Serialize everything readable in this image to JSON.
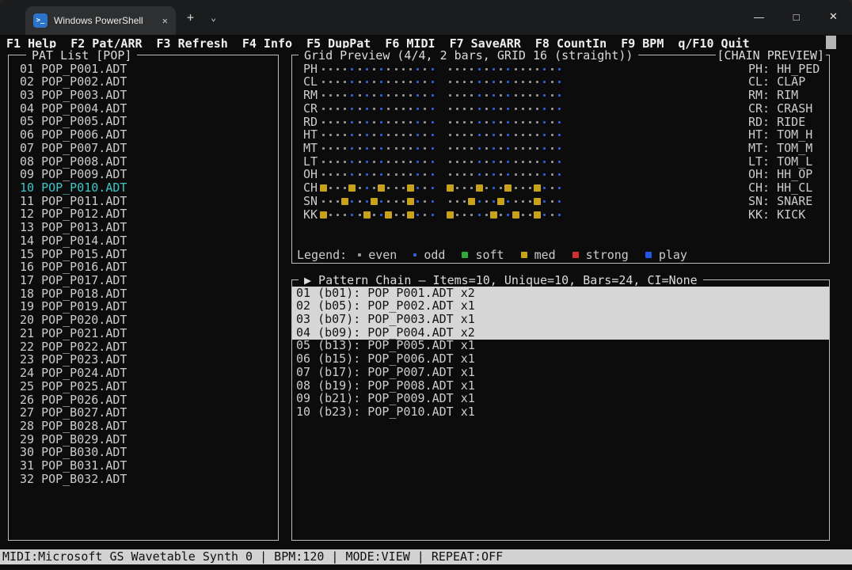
{
  "window": {
    "tab_title": "Windows PowerShell",
    "ps_icon_text": ">_",
    "tab_close_glyph": "✕",
    "new_tab_glyph": "+",
    "dropdown_glyph": "⌄",
    "minimize_glyph": "—",
    "maximize_glyph": "□",
    "close_glyph": "✕"
  },
  "menu": {
    "items": [
      {
        "key": "F1",
        "label": "Help"
      },
      {
        "key": "F2",
        "label": "Pat/ARR"
      },
      {
        "key": "F3",
        "label": "Refresh"
      },
      {
        "key": "F4",
        "label": "Info"
      },
      {
        "key": "F5",
        "label": "DupPat"
      },
      {
        "key": "F6",
        "label": "MIDI"
      },
      {
        "key": "F7",
        "label": "SaveARR"
      },
      {
        "key": "F8",
        "label": "CountIn"
      },
      {
        "key": "F9",
        "label": "BPM"
      },
      {
        "key": "q/F10",
        "label": "Quit"
      }
    ]
  },
  "pat_list": {
    "title": "PAT List [POP]",
    "selected_num": "10",
    "items": [
      {
        "num": "01",
        "name": "POP_P001.ADT"
      },
      {
        "num": "02",
        "name": "POP_P002.ADT"
      },
      {
        "num": "03",
        "name": "POP_P003.ADT"
      },
      {
        "num": "04",
        "name": "POP_P004.ADT"
      },
      {
        "num": "05",
        "name": "POP_P005.ADT"
      },
      {
        "num": "06",
        "name": "POP_P006.ADT"
      },
      {
        "num": "07",
        "name": "POP_P007.ADT"
      },
      {
        "num": "08",
        "name": "POP_P008.ADT"
      },
      {
        "num": "09",
        "name": "POP_P009.ADT"
      },
      {
        "num": "10",
        "name": "POP_P010.ADT"
      },
      {
        "num": "11",
        "name": "POP_P011.ADT"
      },
      {
        "num": "12",
        "name": "POP_P012.ADT"
      },
      {
        "num": "13",
        "name": "POP_P013.ADT"
      },
      {
        "num": "14",
        "name": "POP_P014.ADT"
      },
      {
        "num": "15",
        "name": "POP_P015.ADT"
      },
      {
        "num": "16",
        "name": "POP_P016.ADT"
      },
      {
        "num": "17",
        "name": "POP_P017.ADT"
      },
      {
        "num": "18",
        "name": "POP_P018.ADT"
      },
      {
        "num": "19",
        "name": "POP_P019.ADT"
      },
      {
        "num": "20",
        "name": "POP_P020.ADT"
      },
      {
        "num": "21",
        "name": "POP_P021.ADT"
      },
      {
        "num": "22",
        "name": "POP_P022.ADT"
      },
      {
        "num": "23",
        "name": "POP_P023.ADT"
      },
      {
        "num": "24",
        "name": "POP_P024.ADT"
      },
      {
        "num": "25",
        "name": "POP_P025.ADT"
      },
      {
        "num": "26",
        "name": "POP_P026.ADT"
      },
      {
        "num": "27",
        "name": "POP_B027.ADT"
      },
      {
        "num": "28",
        "name": "POP_B028.ADT"
      },
      {
        "num": "29",
        "name": "POP_B029.ADT"
      },
      {
        "num": "30",
        "name": "POP_B030.ADT"
      },
      {
        "num": "31",
        "name": "POP_B031.ADT"
      },
      {
        "num": "32",
        "name": "POP_B032.ADT"
      }
    ]
  },
  "grid": {
    "title": "Grid Preview (4/4, 2 bars, GRID 16 (straight))",
    "chain_preview_label": "[CHAIN PREVIEW]",
    "bars": 2,
    "steps_per_bar": 16,
    "dot_pattern": "EEEEOEOEOEEEEOEO",
    "rows": [
      {
        "abbr": "PH",
        "name": "HH_PED",
        "hits": []
      },
      {
        "abbr": "CL",
        "name": "CLAP",
        "hits": []
      },
      {
        "abbr": "RM",
        "name": "RIM",
        "hits": []
      },
      {
        "abbr": "CR",
        "name": "CRASH",
        "hits": []
      },
      {
        "abbr": "RD",
        "name": "RIDE",
        "hits": []
      },
      {
        "abbr": "HT",
        "name": "TOM_H",
        "hits": []
      },
      {
        "abbr": "MT",
        "name": "TOM_M",
        "hits": []
      },
      {
        "abbr": "LT",
        "name": "TOM_L",
        "hits": []
      },
      {
        "abbr": "OH",
        "name": "HH_OP",
        "hits": []
      },
      {
        "abbr": "CH",
        "name": "HH_CL",
        "hits": [
          1,
          5,
          9,
          13
        ]
      },
      {
        "abbr": "SN",
        "name": "SNARE",
        "hits": [
          4,
          8,
          13
        ]
      },
      {
        "abbr": "KK",
        "name": "KICK",
        "hits": [
          1,
          7,
          10,
          13
        ]
      }
    ],
    "legend": {
      "label": "Legend:",
      "items": [
        {
          "glyph": "dot",
          "color_key": "dot_even",
          "label": "even"
        },
        {
          "glyph": "dot",
          "color_key": "dot_odd",
          "label": "odd"
        },
        {
          "glyph": "square",
          "color_key": "soft",
          "label": "soft"
        },
        {
          "glyph": "square",
          "color_key": "med",
          "label": "med"
        },
        {
          "glyph": "square",
          "color_key": "strong",
          "label": "strong"
        },
        {
          "glyph": "square",
          "color_key": "play",
          "label": "play"
        }
      ]
    }
  },
  "chain": {
    "title_icon": "▶",
    "title": "Pattern Chain — Items=10, Unique=10, Bars=24, CI=None",
    "items": [
      {
        "num": "01",
        "bar": "b01",
        "name": "POP_P001.ADT",
        "reps": "x2",
        "highlight": true
      },
      {
        "num": "02",
        "bar": "b05",
        "name": "POP_P002.ADT",
        "reps": "x1",
        "highlight": true
      },
      {
        "num": "03",
        "bar": "b07",
        "name": "POP_P003.ADT",
        "reps": "x1",
        "highlight": true
      },
      {
        "num": "04",
        "bar": "b09",
        "name": "POP_P004.ADT",
        "reps": "x2",
        "highlight": true
      },
      {
        "num": "05",
        "bar": "b13",
        "name": "POP_P005.ADT",
        "reps": "x1",
        "highlight": false
      },
      {
        "num": "06",
        "bar": "b15",
        "name": "POP_P006.ADT",
        "reps": "x1",
        "highlight": false
      },
      {
        "num": "07",
        "bar": "b17",
        "name": "POP_P007.ADT",
        "reps": "x1",
        "highlight": false
      },
      {
        "num": "08",
        "bar": "b19",
        "name": "POP_P008.ADT",
        "reps": "x1",
        "highlight": false
      },
      {
        "num": "09",
        "bar": "b21",
        "name": "POP_P009.ADT",
        "reps": "x1",
        "highlight": false
      },
      {
        "num": "10",
        "bar": "b23",
        "name": "POP_P010.ADT",
        "reps": "x1",
        "highlight": false
      }
    ]
  },
  "status": {
    "text": "MIDI:Microsoft GS Wavetable Synth 0 | BPM:120 | MODE:VIEW | REPEAT:OFF"
  },
  "colors": {
    "dot_even": "#969696",
    "dot_odd": "#2d62d8",
    "soft": "#2fa83c",
    "med": "#c9a21b",
    "strong": "#d2312e",
    "play": "#2257e6",
    "selected": "#3ec6c8"
  }
}
